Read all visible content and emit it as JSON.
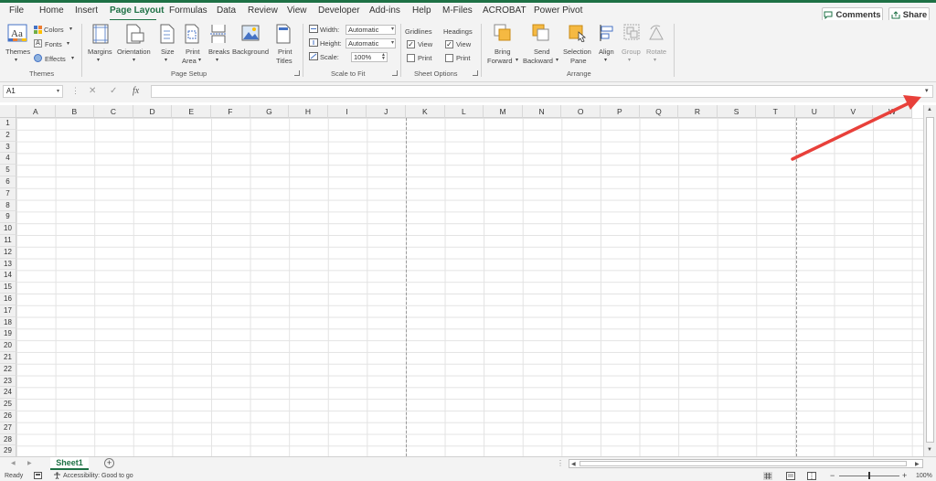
{
  "tabs": [
    "File",
    "Home",
    "Insert",
    "Page Layout",
    "Formulas",
    "Data",
    "Review",
    "View",
    "Developer",
    "Add-ins",
    "Help",
    "M-Files",
    "ACROBAT",
    "Power Pivot"
  ],
  "active_tab": "Page Layout",
  "header_buttons": {
    "comments": "Comments",
    "share": "Share"
  },
  "ribbon": {
    "themes_group": {
      "label": "Themes",
      "themes": "Themes",
      "colors": "Colors",
      "fonts": "Fonts",
      "effects": "Effects"
    },
    "page_setup_group": {
      "label": "Page Setup",
      "margins": "Margins",
      "orientation": "Orientation",
      "size": "Size",
      "print_area_1": "Print",
      "print_area_2": "Area",
      "breaks": "Breaks",
      "background": "Background",
      "print_titles_1": "Print",
      "print_titles_2": "Titles"
    },
    "scale_group": {
      "label": "Scale to Fit",
      "width_label": "Width:",
      "width_value": "Automatic",
      "height_label": "Height:",
      "height_value": "Automatic",
      "scale_label": "Scale:",
      "scale_value": "100%"
    },
    "sheet_options_group": {
      "label": "Sheet Options",
      "gridlines": "Gridlines",
      "headings": "Headings",
      "view": "View",
      "print": "Print"
    },
    "arrange_group": {
      "label": "Arrange",
      "bring_1": "Bring",
      "bring_2": "Forward",
      "send_1": "Send",
      "send_2": "Backward",
      "sel_1": "Selection",
      "sel_2": "Pane",
      "align": "Align",
      "group": "Group",
      "rotate": "Rotate"
    }
  },
  "formula_bar": {
    "name_box": "A1",
    "fx": "fx",
    "value": ""
  },
  "columns": [
    "A",
    "B",
    "C",
    "D",
    "E",
    "F",
    "G",
    "H",
    "I",
    "J",
    "K",
    "L",
    "M",
    "N",
    "O",
    "P",
    "Q",
    "R",
    "S",
    "T",
    "U",
    "V",
    "W"
  ],
  "rows": [
    "1",
    "2",
    "3",
    "4",
    "5",
    "6",
    "7",
    "8",
    "9",
    "10",
    "11",
    "12",
    "13",
    "14",
    "15",
    "16",
    "17",
    "18",
    "19",
    "20",
    "21",
    "22",
    "23",
    "24",
    "25",
    "26",
    "27",
    "28",
    "29"
  ],
  "sheet_tab": "Sheet1",
  "status": {
    "ready": "Ready",
    "accessibility": "Accessibility: Good to go",
    "zoom": "100%"
  },
  "colors": {
    "accent": "#1e7145",
    "annotation_arrow": "#e8403a"
  }
}
